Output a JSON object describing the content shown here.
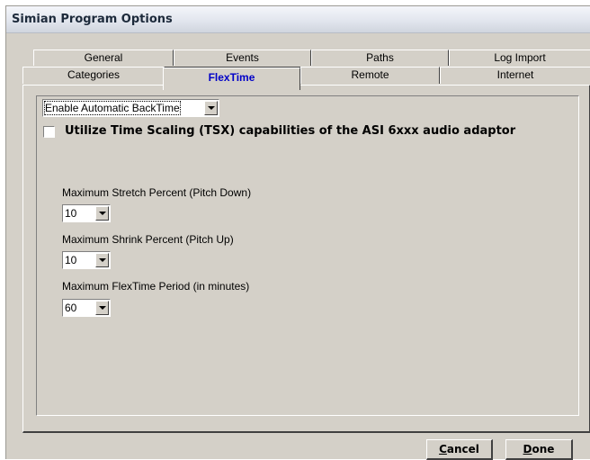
{
  "window": {
    "title": "Simian Program Options"
  },
  "tabs": {
    "row1": [
      "General",
      "Events",
      "Paths",
      "Log Import"
    ],
    "row2": [
      "Categories",
      "FlexTime",
      "Remote",
      "Internet"
    ],
    "active": "FlexTime"
  },
  "flextime": {
    "mode_select": "Enable Automatic BackTime",
    "tsx_checkbox_label": "Utilize Time Scaling (TSX) capabilities of the ASI 6xxx audio adaptor",
    "tsx_checked": false,
    "stretch": {
      "label": "Maximum Stretch Percent (Pitch Down)",
      "value": "10"
    },
    "shrink": {
      "label": "Maximum Shrink Percent (Pitch Up)",
      "value": "10"
    },
    "period": {
      "label": "Maximum FlexTime Period (in minutes)",
      "value": "60"
    }
  },
  "buttons": {
    "cancel_mnemonic": "C",
    "cancel_rest": "ancel",
    "done_mnemonic": "D",
    "done_rest": "one"
  }
}
